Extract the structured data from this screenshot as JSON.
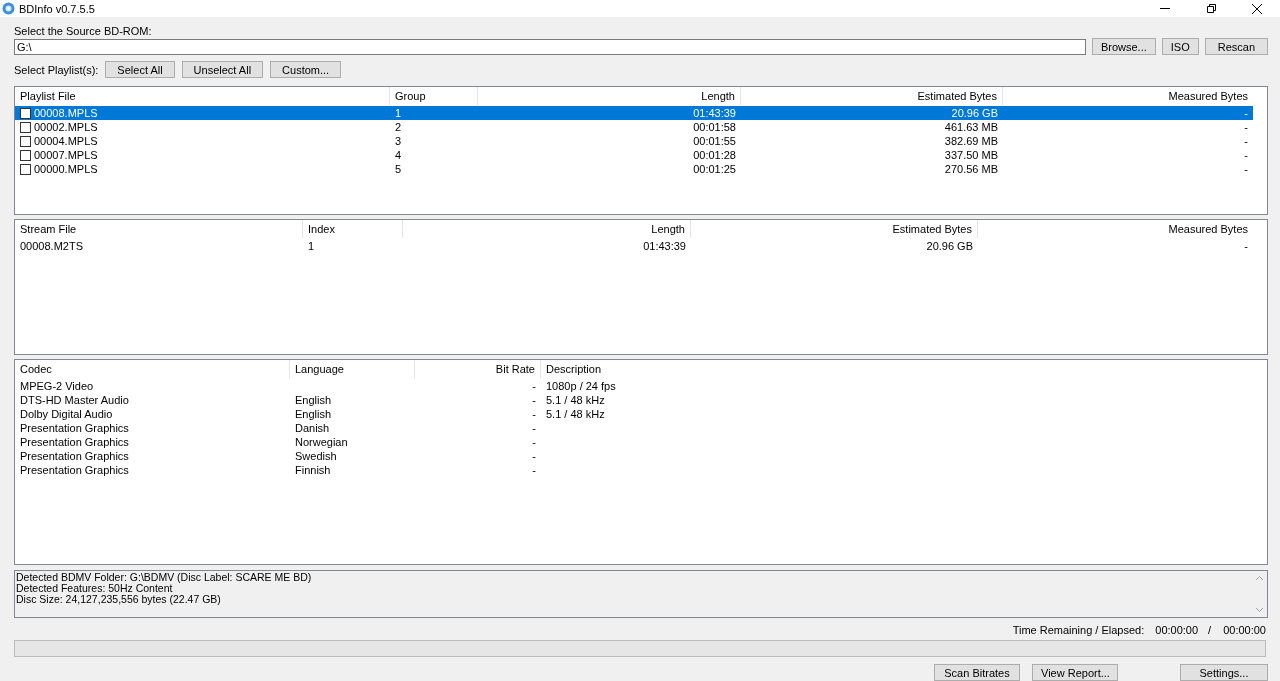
{
  "window": {
    "title": "BDInfo v0.7.5.5"
  },
  "source": {
    "label": "Select the Source BD-ROM:",
    "value": "G:\\",
    "buttons": [
      "Browse...",
      "ISO",
      "Rescan"
    ]
  },
  "playlist_select": {
    "label": "Select Playlist(s):",
    "buttons": [
      "Select All",
      "Unselect All",
      "Custom..."
    ]
  },
  "playlists": {
    "columns": [
      "Playlist File",
      "Group",
      "Length",
      "Estimated Bytes",
      "Measured Bytes"
    ],
    "rows": [
      {
        "cells": [
          "00008.MPLS",
          "1",
          "01:43:39",
          "20.96 GB",
          "-"
        ],
        "checked": false,
        "selected": true
      },
      {
        "cells": [
          "00002.MPLS",
          "2",
          "00:01:58",
          "461.63 MB",
          "-"
        ],
        "checked": false,
        "selected": false
      },
      {
        "cells": [
          "00004.MPLS",
          "3",
          "00:01:55",
          "382.69 MB",
          "-"
        ],
        "checked": false,
        "selected": false
      },
      {
        "cells": [
          "00007.MPLS",
          "4",
          "00:01:28",
          "337.50 MB",
          "-"
        ],
        "checked": false,
        "selected": false
      },
      {
        "cells": [
          "00000.MPLS",
          "5",
          "00:01:25",
          "270.56 MB",
          "-"
        ],
        "checked": false,
        "selected": false
      }
    ]
  },
  "streams": {
    "columns": [
      "Stream File",
      "Index",
      "Length",
      "Estimated Bytes",
      "Measured Bytes"
    ],
    "rows": [
      {
        "cells": [
          "00008.M2TS",
          "1",
          "01:43:39",
          "20.96 GB",
          "-"
        ]
      }
    ]
  },
  "codecs": {
    "columns": [
      "Codec",
      "Language",
      "Bit Rate",
      "Description"
    ],
    "rows": [
      {
        "cells": [
          "MPEG-2 Video",
          "",
          "-",
          "1080p / 24 fps"
        ]
      },
      {
        "cells": [
          "DTS-HD Master Audio",
          "English",
          "-",
          "5.1 / 48 kHz"
        ]
      },
      {
        "cells": [
          "Dolby Digital Audio",
          "English",
          "-",
          "5.1 / 48 kHz"
        ]
      },
      {
        "cells": [
          "Presentation Graphics",
          "Danish",
          "-",
          ""
        ]
      },
      {
        "cells": [
          "Presentation Graphics",
          "Norwegian",
          "-",
          ""
        ]
      },
      {
        "cells": [
          "Presentation Graphics",
          "Swedish",
          "-",
          ""
        ]
      },
      {
        "cells": [
          "Presentation Graphics",
          "Finnish",
          "-",
          ""
        ]
      }
    ]
  },
  "info": [
    "Detected BDMV Folder: G:\\BDMV (Disc Label: SCARE ME BD)",
    "Detected Features: 50Hz Content",
    "Disc Size: 24,127,235,556 bytes (22.47 GB)"
  ],
  "time": {
    "label": "Time Remaining / Elapsed:",
    "remaining": "00:00:00",
    "separator": "/",
    "elapsed": "00:00:00"
  },
  "progress": {
    "level": 0
  },
  "buttons": [
    "Scan Bitrates",
    "View Report...",
    "Settings..."
  ]
}
